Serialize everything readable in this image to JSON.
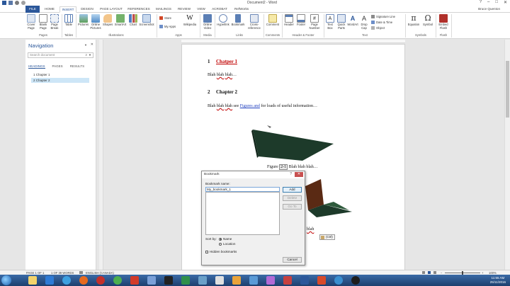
{
  "app": {
    "title": "Document2 - Word",
    "user": "Bruce Quenton",
    "window_controls": [
      "?",
      "–",
      "□",
      "✕"
    ]
  },
  "ribbon_tabs": [
    "FILE",
    "HOME",
    "INSERT",
    "DESIGN",
    "PAGE LAYOUT",
    "REFERENCES",
    "MAILINGS",
    "REVIEW",
    "VIEW",
    "ACROBAT",
    "RefWorks"
  ],
  "active_tab": "INSERT",
  "ribbon": {
    "buttons": {
      "cover_page": "Cover Page",
      "blank_page": "Blank Page",
      "page_break": "Page Break",
      "table": "Table",
      "pictures": "Pictures",
      "online_pictures": "Online Pictures",
      "shapes": "Shapes",
      "smartart": "SmartArt",
      "chart": "Chart",
      "screenshot": "Screenshot",
      "store": "Store",
      "my_apps": "My Apps",
      "wikipedia": "Wikipedia",
      "online_video": "Online Video",
      "hyperlink": "Hyperlink",
      "bookmark": "Bookmark",
      "cross_reference": "Cross-reference",
      "comment": "Comment",
      "header": "Header",
      "footer": "Footer",
      "page_number": "Page Number",
      "text_box": "Text Box",
      "quick_parts": "Quick Parts",
      "wordart": "WordArt",
      "drop_cap": "Drop Cap",
      "signature_line": "Signature Line",
      "date_time": "Date & Time",
      "object": "Object",
      "equation": "Equation",
      "symbol": "Symbol",
      "embed_flash": "Embed Flash"
    },
    "groups": {
      "pages": "Pages",
      "tables": "Tables",
      "illustrations": "Illustrations",
      "apps": "Apps",
      "media": "Media",
      "links": "Links",
      "comments": "Comments",
      "header_footer": "Header & Footer",
      "text": "Text",
      "symbols": "Symbols",
      "flash": "Flash"
    }
  },
  "nav": {
    "title": "Navigation",
    "search_placeholder": "Search document",
    "tabs": [
      "HEADINGS",
      "PAGES",
      "RESULTS"
    ],
    "headings": [
      "1 Chapter 1",
      "2 Chapter 2"
    ]
  },
  "document": {
    "heading1_num": "1",
    "heading1_text": "Chatper 1",
    "para1": [
      "Blah ",
      "blah",
      " ",
      "blah",
      "…"
    ],
    "heading2_num": "2",
    "heading2_text": "Chapter 2",
    "para2_a": "Blah ",
    "para2_b": "blah",
    "para2_c": " ",
    "para2_d": "blah",
    "para2_e": " see ",
    "para2_link": "Figures  and",
    "para2_f": "  for loads of useful information…",
    "caption_label": "Figure ",
    "caption_num": "2-1",
    "caption_rest": "  Blah ",
    "caption_b1": "blah",
    "caption_sp": " ",
    "caption_b2": "blah",
    "caption_end": "…",
    "obscured_text": "blah",
    "paste_tag": "(Ctrl)"
  },
  "dialog": {
    "title": "Bookmark",
    "help": "?",
    "close": "✕",
    "name_label": "Bookmark name:",
    "name_value": "My_bookmark_1",
    "buttons": {
      "add": "Add",
      "delete": "Delete",
      "goto": "Go To",
      "cancel": "Cancel"
    },
    "sort_label": "Sort by:",
    "sort_name": "Name",
    "sort_location": "Location",
    "hidden_label": "Hidden bookmarks"
  },
  "status": {
    "page": "PAGE 1 OF 1",
    "words": "1 OF 39 WORDS",
    "language": "ENGLISH (CANADA)",
    "zoom": "100%"
  },
  "taskbar": {
    "time": "11:55 AM",
    "date": "25/11/2016"
  },
  "colors": {
    "accent": "#2b579a",
    "heading_red": "#c00000",
    "shape_dark": "#1d3a2a",
    "shape_brown": "#5a2a14"
  }
}
